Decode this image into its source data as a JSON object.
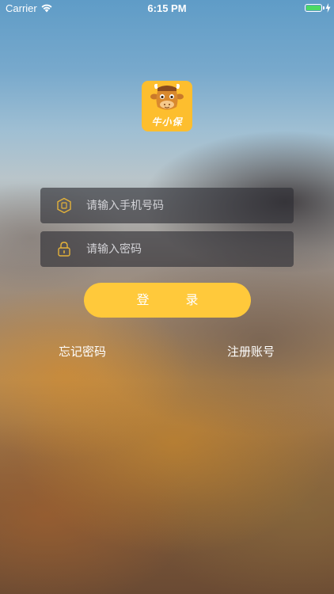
{
  "status_bar": {
    "carrier": "Carrier",
    "time": "6:15 PM",
    "battery_level": 1.0,
    "battery_color": "#4cd964",
    "wifi_icon": "wifi-icon",
    "charging_icon": "bolt-icon"
  },
  "logo": {
    "text": "牛小保",
    "icon": "cow-head-icon",
    "background": "#fdbe2e"
  },
  "form": {
    "phone": {
      "placeholder": "请输入手机号码",
      "value": "",
      "icon": "phone-icon"
    },
    "password": {
      "placeholder": "请输入密码",
      "value": "",
      "icon": "lock-icon"
    },
    "login_label": "登录",
    "login_color": "#ffc93b",
    "icon_color": "#e4b23a"
  },
  "links": {
    "forgot_password": "忘记密码",
    "register": "注册账号"
  }
}
